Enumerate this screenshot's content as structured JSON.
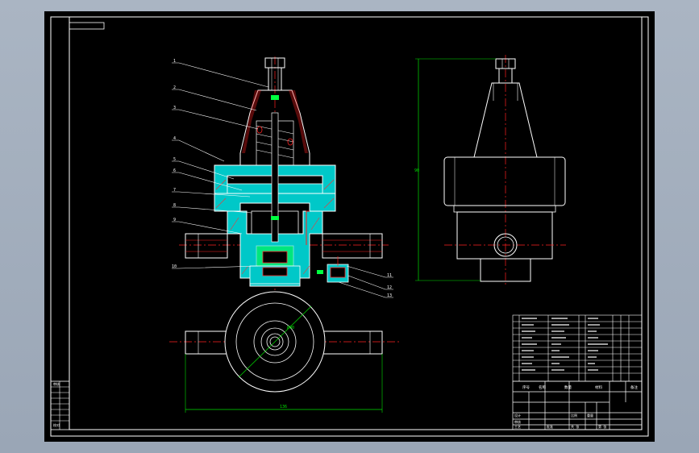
{
  "canvas": {
    "viewport_color": "#a9b4c2",
    "paper_color": "#000000"
  },
  "colors": {
    "outline": "#ffffff",
    "centerline": "#ff2020",
    "dimension": "#00e000",
    "section_fill": "#00c8c8",
    "hatch": "#ff3030",
    "leader": "#ffffff",
    "highlight": "#00ff40"
  },
  "balloons": [
    "1",
    "2",
    "3",
    "4",
    "5",
    "6",
    "7",
    "8",
    "9",
    "10",
    "11",
    "12",
    "13"
  ],
  "dimension_labels": {
    "height": "90",
    "width": "136",
    "diameter": "Ø90"
  },
  "left_strip": [
    "审核",
    "",
    "",
    "",
    "",
    "",
    "",
    "校对"
  ],
  "parts_list": {
    "rows": 10,
    "header": [
      "序号",
      "名称",
      "数量",
      "材料",
      "备注"
    ]
  },
  "title_block": {
    "labels": [
      "设计",
      "审核",
      "工艺",
      "批准",
      "比例",
      "重量",
      "共 张",
      "第 张"
    ]
  }
}
